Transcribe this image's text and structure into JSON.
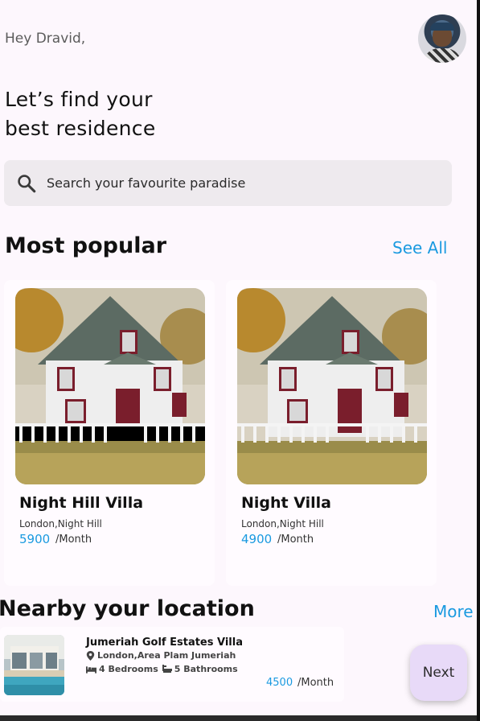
{
  "header": {
    "greeting": "Hey Dravid,",
    "headline_line1": "Let’s find your",
    "headline_line2": "best residence"
  },
  "search": {
    "placeholder": "Search your favourite paradise"
  },
  "most_popular": {
    "title": "Most popular",
    "see_all_label": "See All",
    "cards": [
      {
        "name": "Night Hill Villa",
        "location": "London,Night Hill",
        "price": "5900",
        "period": "/Month"
      },
      {
        "name": "Night Villa",
        "location": "London,Night Hill",
        "price": "4900",
        "period": "/Month"
      }
    ]
  },
  "nearby": {
    "title": "Nearby your location",
    "more_label": "More",
    "items": [
      {
        "name": "Jumeriah Golf Estates Villa",
        "location": "London,Area Plam Jumeriah",
        "bedrooms": "4 Bedrooms",
        "bathrooms": "5 Bathrooms",
        "price": "4500",
        "period": "/Month"
      }
    ]
  },
  "next_button_label": "Next",
  "colors": {
    "accent": "#1a9ae0",
    "background": "#fdf7fd",
    "search_bg": "#eeeaee",
    "next_button_bg": "#e8daf8"
  },
  "icons": {
    "search": "search-icon",
    "location": "location-pin-icon",
    "bed": "bed-icon",
    "bath": "bathtub-icon"
  }
}
